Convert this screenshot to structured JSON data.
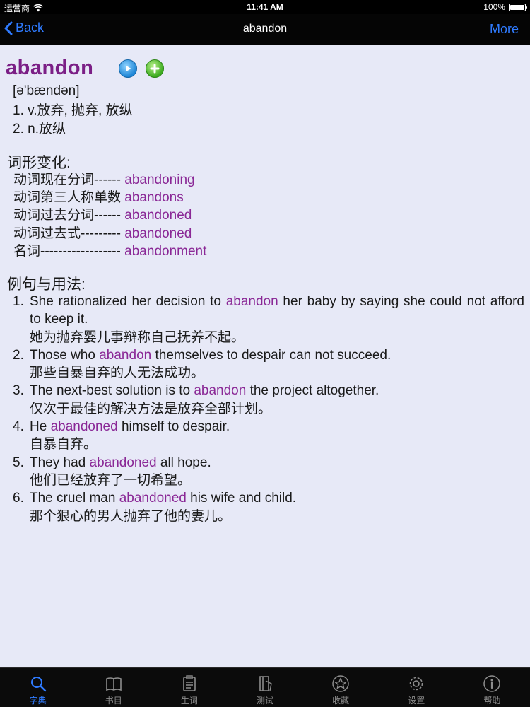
{
  "status_bar": {
    "carrier": "运营商",
    "time": "11:41 AM",
    "battery": "100%",
    "battery_level": 1.0
  },
  "nav": {
    "back_label": "Back",
    "title": "abandon",
    "more_label": "More"
  },
  "entry": {
    "headword": "abandon",
    "phonetic": "[ə'bændən]",
    "definitions": [
      "1. v.放弃, 抛弃, 放纵",
      "2. n.放纵"
    ]
  },
  "forms_section": {
    "title": "词形变化:",
    "items": [
      {
        "label": "动词现在分词------ ",
        "value": "abandoning"
      },
      {
        "label": "动词第三人称单数 ",
        "value": "abandons"
      },
      {
        "label": "动词过去分词------ ",
        "value": "abandoned"
      },
      {
        "label": "动词过去式--------- ",
        "value": "abandoned"
      },
      {
        "label": "名词------------------ ",
        "value": "abandonment"
      }
    ]
  },
  "examples_section": {
    "title": "例句与用法:",
    "items": [
      {
        "num": "1.",
        "before": "She rationalized her decision to ",
        "word": "abandon",
        "after": " her baby by saying she could not afford to keep it.",
        "zh": "她为抛弃婴儿事辩称自己抚养不起。"
      },
      {
        "num": "2.",
        "before": "Those who ",
        "word": "abandon",
        "after": " themselves to despair can not succeed.",
        "zh": "那些自暴自弃的人无法成功。"
      },
      {
        "num": "3.",
        "before": "The next-best solution is to ",
        "word": "abandon",
        "after": " the project altogether.",
        "zh": "仅次于最佳的解决方法是放弃全部计划。"
      },
      {
        "num": "4.",
        "before": "He ",
        "word": "abandoned",
        "after": " himself to despair.",
        "zh": "自暴自弃。"
      },
      {
        "num": "5.",
        "before": "They had ",
        "word": "abandoned",
        "after": " all hope.",
        "zh": "他们已经放弃了一切希望。"
      },
      {
        "num": "6.",
        "before": "The cruel man ",
        "word": "abandoned",
        "after": " his wife and child.",
        "zh": "那个狠心的男人抛弃了他的妻儿。"
      }
    ]
  },
  "tabs": [
    {
      "label": "字典",
      "icon": "search-icon",
      "active": true
    },
    {
      "label": "书目",
      "icon": "book-icon",
      "active": false
    },
    {
      "label": "生词",
      "icon": "clipboard-icon",
      "active": false
    },
    {
      "label": "测试",
      "icon": "test-book-icon",
      "active": false
    },
    {
      "label": "收藏",
      "icon": "star-icon",
      "active": false
    },
    {
      "label": "设置",
      "icon": "gear-icon",
      "active": false
    },
    {
      "label": "帮助",
      "icon": "info-icon",
      "active": false
    }
  ],
  "colors": {
    "accent": "#2f7bff",
    "highlight": "#8a2896",
    "headword": "#7b1f86",
    "background": "#e7e9f7"
  }
}
